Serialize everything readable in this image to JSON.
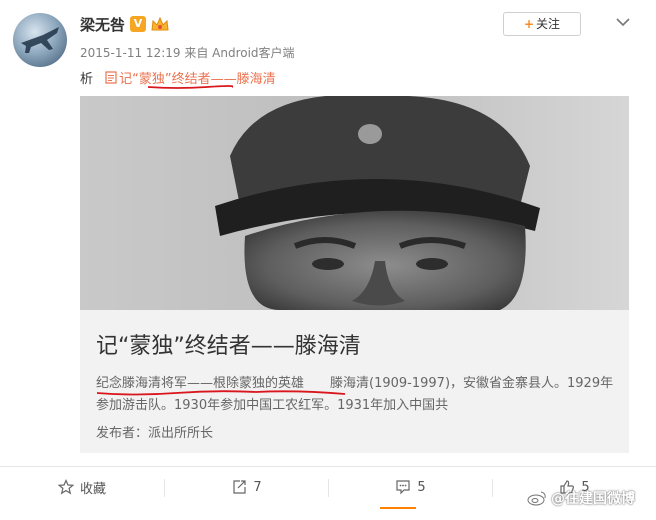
{
  "user": {
    "name": "梁无咎",
    "verified_badge": "V",
    "avatar_icon": "fighter-jet-avatar",
    "vip_icon": "vip-crown-icon"
  },
  "header": {
    "follow_plus": "+",
    "follow_label": "关注",
    "more_icon": "chevron-down-icon"
  },
  "meta": {
    "timestamp": "2015-1-11 12:19",
    "source": "来自 Android客户端"
  },
  "post": {
    "text_prefix": "析",
    "link_icon": "article-icon",
    "link_text": "记“蒙独”终结者——滕海清"
  },
  "card": {
    "image_desc_icon": "portrait-photo",
    "title": "记“蒙独”终结者——滕海清",
    "lead": "纪念滕海清将军——根除蒙独的英雄",
    "body": "滕海清(1909-1997)，安徽省金寨县人。1929年参加游击队。1930年参加中国工农红军。1931年加入中国共",
    "author": "发布者：派出所所长"
  },
  "actions": {
    "favorite_label": "收藏",
    "repost_count": "7",
    "comment_count": "5",
    "like_count": "5"
  },
  "watermark": {
    "text": "@往建国微博"
  },
  "colors": {
    "link": "#eb7350",
    "accent": "#ff8200",
    "annotation": "#d9161d"
  }
}
